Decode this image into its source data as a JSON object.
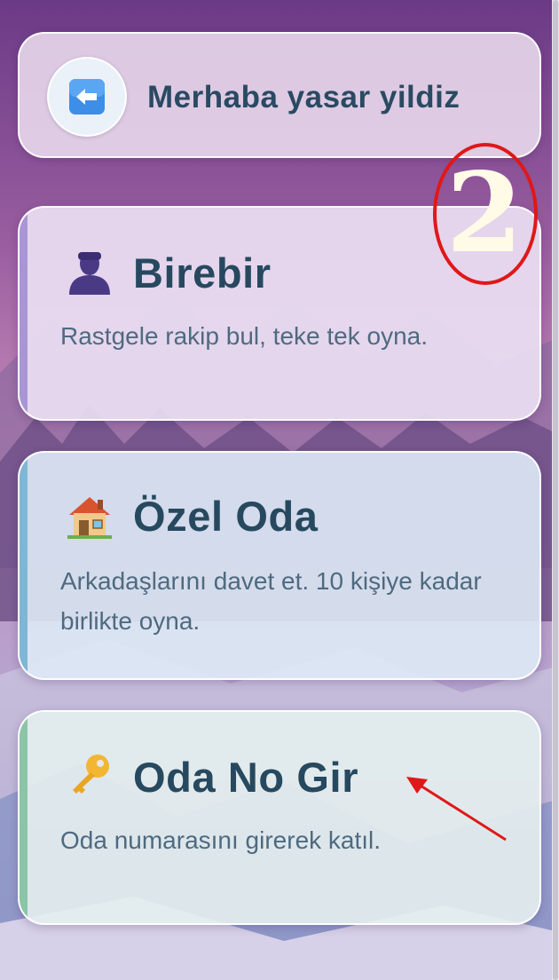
{
  "header": {
    "back_icon": "left-arrow-icon",
    "greeting": "Merhaba yasar yildiz"
  },
  "cards": [
    {
      "icon": "person-silhouette-icon",
      "title": "Birebir",
      "description": "Rastgele rakip bul, teke tek oyna.",
      "accent": "#a996d4"
    },
    {
      "icon": "house-icon",
      "title": "Özel Oda",
      "description": "Arkadaşlarını davet et. 10 kişiye kadar birlikte oyna.",
      "accent": "#7fb6d6"
    },
    {
      "icon": "key-icon",
      "title": "Oda No Gir",
      "description": "Oda numarasını girerek katıl.",
      "accent": "#8cc4a8"
    }
  ],
  "annotation": {
    "number": "2",
    "circle_color": "#e01818",
    "arrow_color": "#e01818"
  },
  "colors": {
    "title_text": "#27495f",
    "description_text": "#4f6a80"
  }
}
